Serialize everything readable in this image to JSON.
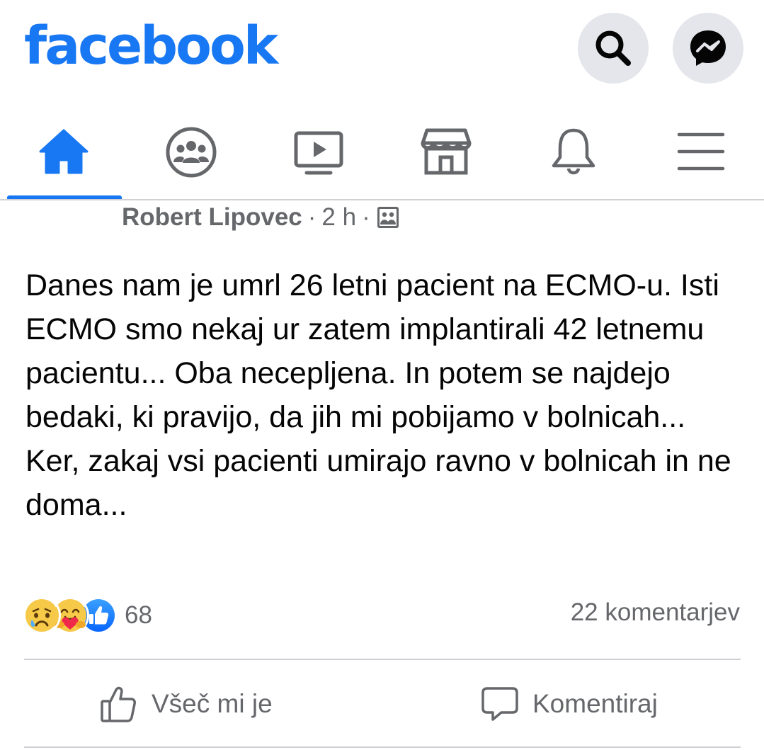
{
  "header": {
    "logo_text": "facebook",
    "brand_color": "#1877f2",
    "search_icon": "search-icon",
    "messenger_icon": "messenger-icon"
  },
  "nav": {
    "tabs": [
      {
        "icon": "home-icon",
        "active": true
      },
      {
        "icon": "groups-icon",
        "active": false
      },
      {
        "icon": "watch-icon",
        "active": false
      },
      {
        "icon": "marketplace-icon",
        "active": false
      },
      {
        "icon": "bell-icon",
        "active": false
      },
      {
        "icon": "menu-icon",
        "active": false
      }
    ]
  },
  "post": {
    "author": "Robert Lipovec",
    "separator": "·",
    "time": "2 h",
    "audience_icon": "audience-icon",
    "text": "Danes nam je umrl 26 letni pacient na ECMO-u. Isti ECMO smo nekaj ur zatem implantirali 42 letnemu pacientu... Oba necepljena. In potem se najdejo bedaki, ki pravijo, da jih mi pobijamo v bolnicah... Ker, zakaj vsi pacienti umirajo ravno v bolnicah in ne doma...",
    "reactions": [
      "sad-reaction-icon",
      "care-reaction-icon",
      "like-reaction-icon"
    ],
    "reaction_count": "68",
    "comments_count": "22 komentarjev",
    "actions": {
      "like_label": "Všeč mi je",
      "comment_label": "Komentiraj"
    }
  }
}
